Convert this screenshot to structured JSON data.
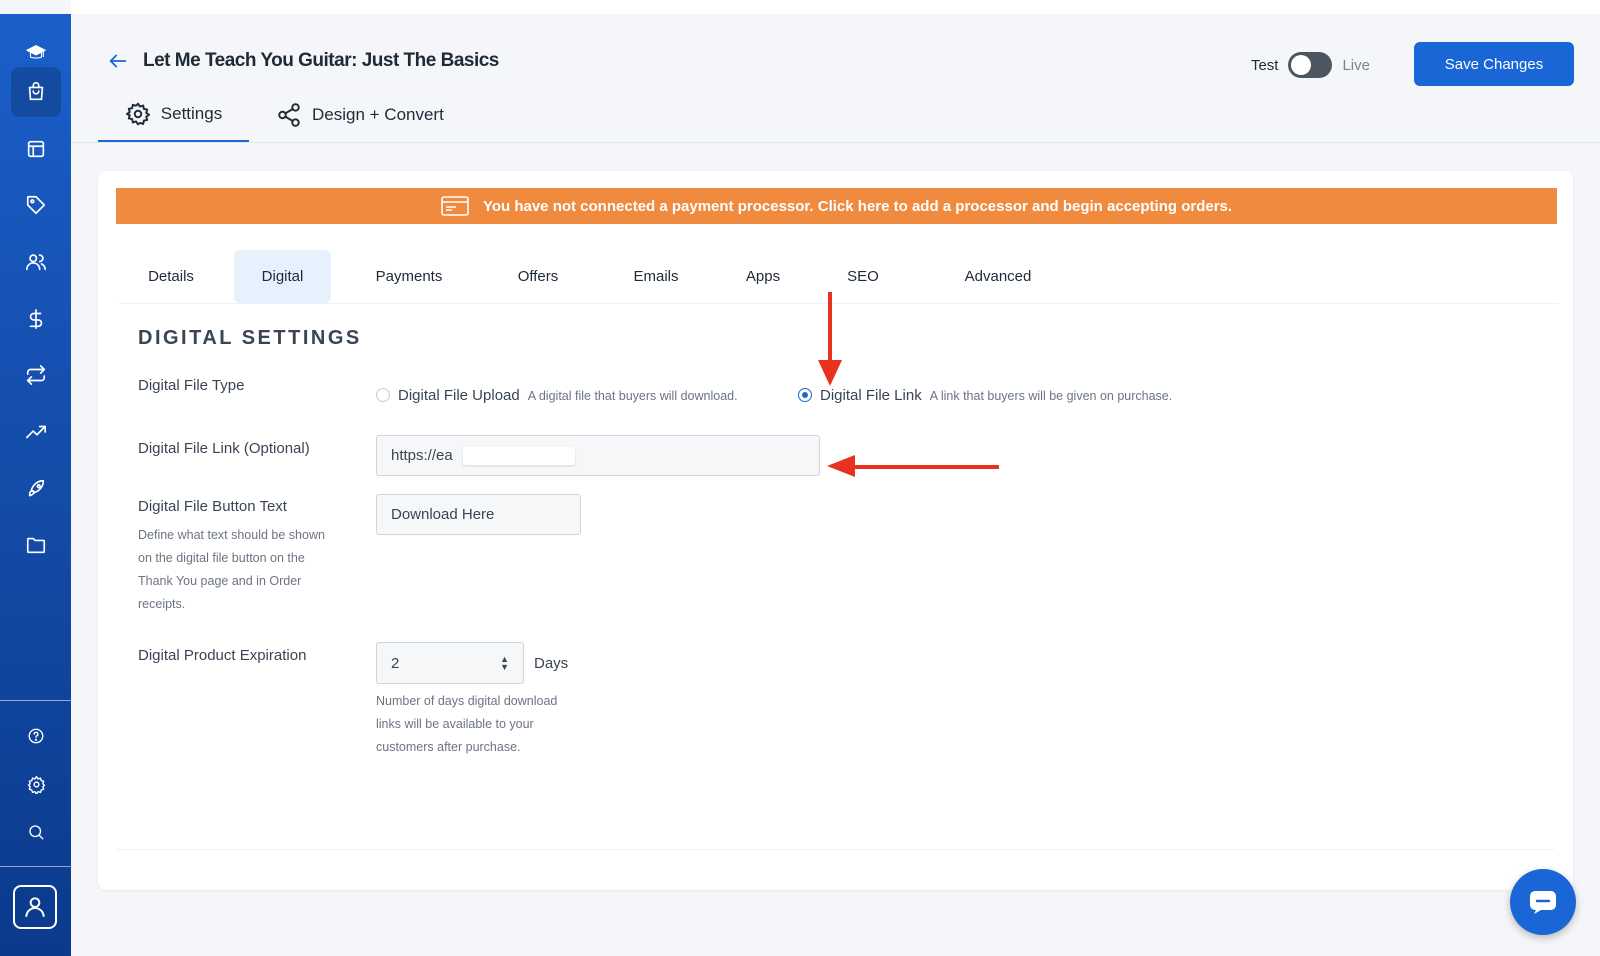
{
  "header": {
    "title": "Let Me Teach You Guitar: Just The Basics",
    "toggle_test": "Test",
    "toggle_live": "Live",
    "save_label": "Save Changes",
    "tabs": [
      {
        "label": "Settings",
        "icon": "gear-icon",
        "active": true
      },
      {
        "label": "Design + Convert",
        "icon": "share-icon",
        "active": false
      }
    ]
  },
  "sidebar": {
    "items": [
      {
        "icon": "logo-icon"
      },
      {
        "icon": "shopping-bag-icon",
        "active": true
      },
      {
        "icon": "layout-icon"
      },
      {
        "icon": "tag-icon"
      },
      {
        "icon": "users-icon"
      },
      {
        "icon": "dollar-icon"
      },
      {
        "icon": "repeat-icon"
      },
      {
        "icon": "trending-up-icon"
      },
      {
        "icon": "rocket-icon"
      },
      {
        "icon": "folder-icon"
      },
      {
        "icon": "help-icon"
      },
      {
        "icon": "settings-icon"
      },
      {
        "icon": "search-icon"
      },
      {
        "icon": "user-avatar-icon"
      }
    ]
  },
  "banner": {
    "text": "You have not connected a payment processor. Click here to add a processor and begin accepting orders.",
    "color": "#f08a3e",
    "icon": "credit-card-icon"
  },
  "subtabs": [
    {
      "label": "Details"
    },
    {
      "label": "Digital",
      "active": true
    },
    {
      "label": "Payments"
    },
    {
      "label": "Offers"
    },
    {
      "label": "Emails"
    },
    {
      "label": "Apps"
    },
    {
      "label": "SEO"
    },
    {
      "label": "Advanced"
    }
  ],
  "digital": {
    "section_title": "DIGITAL SETTINGS",
    "file_type": {
      "label": "Digital File Type",
      "options": [
        {
          "label": "Digital File Upload",
          "desc": "A digital file that buyers will download.",
          "checked": false
        },
        {
          "label": "Digital File Link",
          "desc": "A link that buyers will be given on purchase.",
          "checked": true
        }
      ]
    },
    "file_link": {
      "label": "Digital File Link (Optional)",
      "value": "https://ea"
    },
    "button_text": {
      "label": "Digital File Button Text",
      "help": "Define what text should be shown on the digital file button on the Thank You page and in Order receipts.",
      "value": "Download Here"
    },
    "expiration": {
      "label": "Digital Product Expiration",
      "value": "2",
      "unit": "Days",
      "help": "Number of days digital download links will be available to your customers after purchase."
    }
  },
  "colors": {
    "accent": "#1a66d6",
    "annotation_arrow": "#e8321f"
  }
}
